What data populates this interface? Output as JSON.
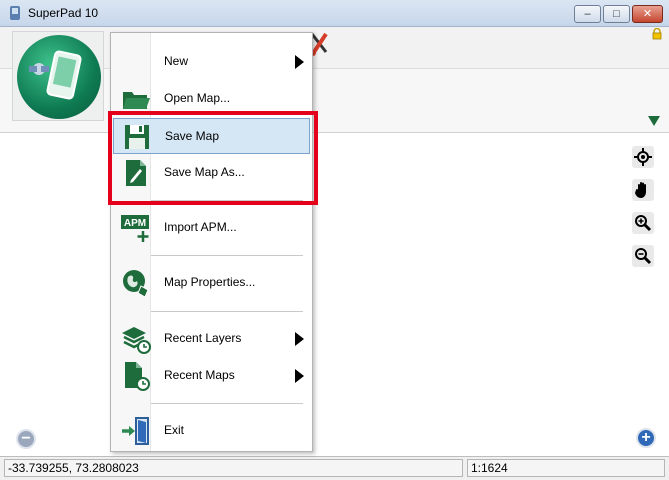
{
  "window": {
    "title": "SuperPad 10",
    "minimize_glyph": "–",
    "maximize_glyph": "□",
    "close_glyph": "✕"
  },
  "ribbon": {
    "lock_icon": "lock-icon",
    "expand_icon": "chevron-down-icon"
  },
  "menu": {
    "items": [
      {
        "label": "New",
        "icon": "new-icon",
        "submenu": true
      },
      {
        "label": "Open Map...",
        "icon": "folder-open-icon",
        "submenu": false
      },
      {
        "label": "Save Map",
        "icon": "save-icon",
        "submenu": false,
        "highlighted": true
      },
      {
        "label": "Save Map As...",
        "icon": "save-as-icon",
        "submenu": false
      },
      {
        "label": "Import APM...",
        "icon": "import-apm-icon",
        "submenu": false
      },
      {
        "label": "Map Properties...",
        "icon": "map-properties-icon",
        "submenu": false
      },
      {
        "label": "Recent Layers",
        "icon": "recent-layers-icon",
        "submenu": true
      },
      {
        "label": "Recent Maps",
        "icon": "recent-maps-icon",
        "submenu": true
      },
      {
        "label": "Exit",
        "icon": "exit-icon",
        "submenu": false
      }
    ],
    "apm_badge": "APM"
  },
  "map_tools": [
    "gps-locate-icon",
    "pan-hand-icon",
    "zoom-in-icon",
    "zoom-out-icon"
  ],
  "map_controls": {
    "zoom_out_glyph": "−",
    "zoom_in_glyph": "+"
  },
  "status": {
    "coordinates": "-33.739255, 73.2808023",
    "scale": "1:1624"
  },
  "colors": {
    "accent_green": "#1e6b3b",
    "highlight_red": "#e4001b",
    "menu_highlight": "#d5e7f5"
  }
}
